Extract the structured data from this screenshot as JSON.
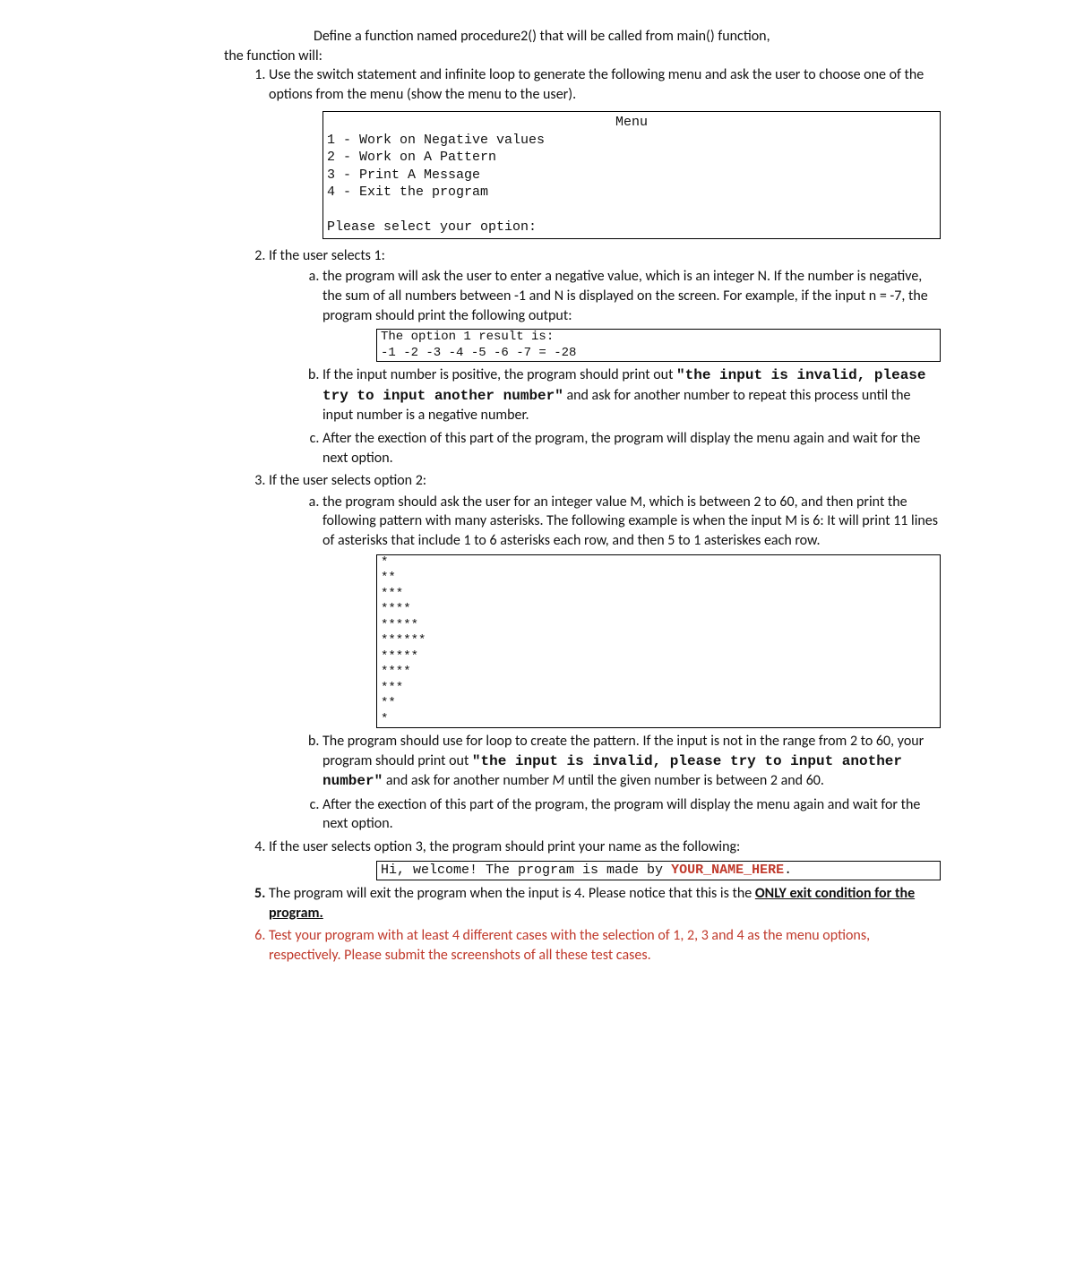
{
  "intro": {
    "line1": "Define a function named procedure2() that will be called from main() function,",
    "line2": "the function will:"
  },
  "items": {
    "i1": {
      "text": "Use the switch statement and infinite loop to generate the following menu and ask the user to choose one of the options from the menu (show the menu to the user)."
    },
    "menu": {
      "title": "Menu",
      "opt1": "1 - Work on Negative values",
      "opt2": "2 - Work on A Pattern",
      "opt3": "3 - Print A Message",
      "opt4": "4 - Exit the program",
      "prompt": "Please select your option:"
    },
    "i2": {
      "head": "If the user selects 1:",
      "a": "the program will ask the user to enter a negative value, which is an integer N. If the number is negative, the sum of all numbers between -1 and N is displayed on the screen. For example, if the input n = -7, the program should print the following output:",
      "code1": "The option 1 result is:",
      "code2": "-1 -2 -3 -4 -5 -6 -7 = -28",
      "b_pre": "If the input number is positive, the program should print out ",
      "b_code": "\"the input is invalid, please try to input another number\"",
      "b_post": " and ask for another number to repeat this process until the input number is a negative number.",
      "c": "After the exection of this part of the program, the program will display the menu again and wait for the next option."
    },
    "i3": {
      "head": "If the user selects option 2:",
      "a": "the program should ask the user for an integer value M, which is between 2 to 60, and then print the following pattern with many asterisks. The following example is when the input M is 6: It will print 11 lines of asterisks that include 1 to 6 asterisks each row, and then 5 to 1 asteriskes each row.",
      "pattern": "*\n**\n***\n****\n*****\n******\n*****\n****\n***\n**\n*",
      "b_pre": "The program should use for loop to create the pattern. If the input is not in the range from 2 to 60, your program should print out ",
      "b_code": "\"the input is invalid, please try to input another number\"",
      "b_post1": " and  ask for another number ",
      "b_italic": "M",
      "b_post2": " until the given number is between 2 and 60.",
      "c": "After the exection of this part of the program, the program will display the menu again and wait for the next option."
    },
    "i4": {
      "text": "If the user selects option 3, the program should print your name as the following:",
      "box_pre": "Hi, welcome! The program is made by ",
      "box_name": "YOUR_NAME_HERE",
      "box_post": "."
    },
    "i5": {
      "pre": "The program will exit the program when the input is 4. Please notice that this is the ",
      "emph": "ONLY exit condition for the program."
    },
    "i6": {
      "text": "Test your program with at least 4 different cases with the selection of 1, 2, 3 and 4 as the menu options, respectively. Please submit the screenshots of all these test cases."
    }
  }
}
